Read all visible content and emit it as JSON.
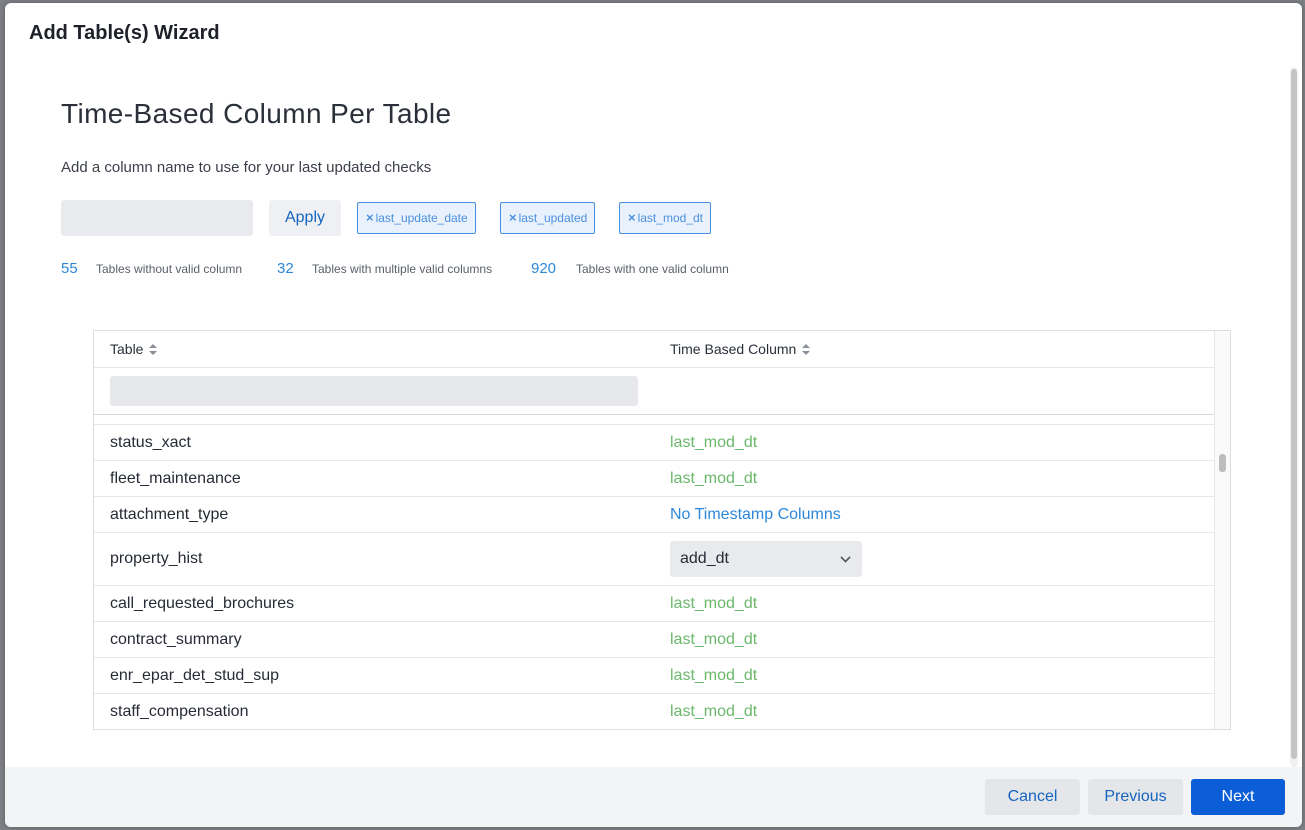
{
  "modal": {
    "title": "Add Table(s) Wizard"
  },
  "step": {
    "title": "Time-Based Column Per Table",
    "subtitle": "Add a column name to use for your last updated checks",
    "column_input_placeholder": "",
    "apply_label": "Apply",
    "tags": [
      {
        "label": "last_update_date"
      },
      {
        "label": "last_updated"
      },
      {
        "label": "last_mod_dt"
      }
    ]
  },
  "stats": [
    {
      "count": "55",
      "label": "Tables without valid column"
    },
    {
      "count": "32",
      "label": "Tables with multiple valid columns"
    },
    {
      "count": "920",
      "label": "Tables with one valid column"
    }
  ],
  "table": {
    "headers": {
      "table": "Table",
      "time_based_column": "Time Based Column"
    },
    "filter_placeholder": "",
    "rows": [
      {
        "table": "status_xact",
        "column": "last_mod_dt",
        "kind": "valid"
      },
      {
        "table": "fleet_maintenance",
        "column": "last_mod_dt",
        "kind": "valid"
      },
      {
        "table": "attachment_type",
        "column": "No Timestamp Columns",
        "kind": "none"
      },
      {
        "table": "property_hist",
        "column": "add_dt",
        "kind": "select"
      },
      {
        "table": "call_requested_brochures",
        "column": "last_mod_dt",
        "kind": "valid"
      },
      {
        "table": "contract_summary",
        "column": "last_mod_dt",
        "kind": "valid"
      },
      {
        "table": "enr_epar_det_stud_sup",
        "column": "last_mod_dt",
        "kind": "valid"
      },
      {
        "table": "staff_compensation",
        "column": "last_mod_dt",
        "kind": "valid"
      }
    ]
  },
  "footer": {
    "cancel_label": "Cancel",
    "previous_label": "Previous",
    "next_label": "Next"
  },
  "colors": {
    "accent": "#0b5ed7",
    "link": "#2d87da",
    "valid": "#6bb86b",
    "tag_border": "#4a8fdf"
  },
  "icons": {
    "tag_remove": "close-icon",
    "sort": "sort-icon",
    "select": "chevron-down-icon"
  }
}
